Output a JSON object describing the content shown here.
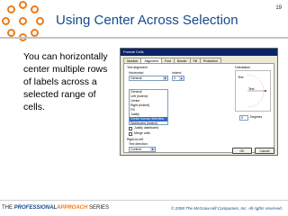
{
  "slide": {
    "number": "19",
    "title": "Using Center Across Selection",
    "body": "You can horizontally center multiple rows of labels across a selected range of cells."
  },
  "dialog": {
    "title": "Format Cells",
    "tabs": [
      {
        "label": "Number",
        "active": false
      },
      {
        "label": "Alignment",
        "active": true
      },
      {
        "label": "Font",
        "active": false
      },
      {
        "label": "Border",
        "active": false
      },
      {
        "label": "Fill",
        "active": false
      },
      {
        "label": "Protection",
        "active": false
      }
    ],
    "text_alignment_label": "Text alignment",
    "horizontal_label": "Horizontal:",
    "horizontal_value": "General",
    "indent_label": "Indent:",
    "indent_value": "0",
    "horizontal_options": [
      {
        "label": "General",
        "selected": false
      },
      {
        "label": "Left (Indent)",
        "selected": false
      },
      {
        "label": "Center",
        "selected": false
      },
      {
        "label": "Right (Indent)",
        "selected": false
      },
      {
        "label": "Fill",
        "selected": false
      },
      {
        "label": "Justify",
        "selected": false
      },
      {
        "label": "Center Across Selection",
        "selected": true
      },
      {
        "label": "Distributed (Indent)",
        "selected": false
      }
    ],
    "justify_distributed_label": "Justify distributed",
    "merge_cells_label": "Merge cells",
    "rtl_label": "Right-to-left",
    "text_direction_label": "Text direction:",
    "text_direction_value": "Context",
    "orientation_label": "Orientation",
    "orientation_vertical_text": "Text",
    "orientation_text": "Text",
    "degrees_value": "0",
    "degrees_label": "Degrees",
    "ok_label": "OK",
    "cancel_label": "Cancel"
  },
  "footer": {
    "brand_the": "THE ",
    "brand_professional": "PROFESSIONAL",
    "brand_approach": "APPROACH",
    "brand_series": " SERIES",
    "copyright": "© 2008 The McGraw-Hill Companies, Inc. All rights reserved."
  },
  "colors": {
    "accent_orange": "#ee7b1a",
    "title_blue": "#124a8c"
  }
}
